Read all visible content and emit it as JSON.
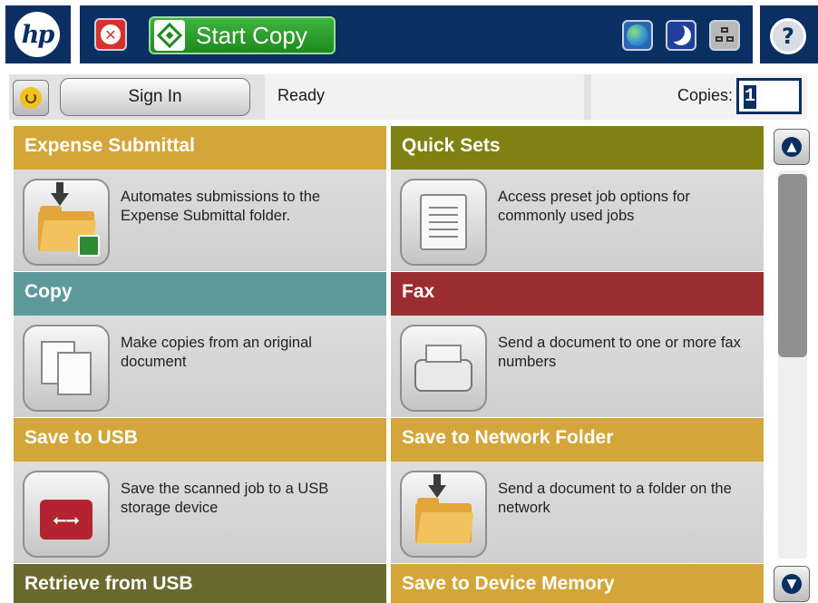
{
  "header": {
    "logo": "hp",
    "start_button_label": "Start Copy",
    "help_glyph": "?",
    "icons": [
      "hp-logo",
      "stop-icon",
      "start-icon",
      "language-globe-icon",
      "sleep-moon-icon",
      "network-icon",
      "help-icon"
    ]
  },
  "status": {
    "sign_in_label": "Sign In",
    "message": "Ready",
    "copies_label": "Copies:",
    "copies_value": "1"
  },
  "tiles": [
    {
      "title": "Expense Submittal",
      "description": "Automates submissions to the Expense Submittal folder.",
      "icon": "expense-submittal-folder-icon",
      "color": "#d4a63a"
    },
    {
      "title": "Quick Sets",
      "description": "Access preset job options for commonly used jobs",
      "icon": "quick-sets-document-icon",
      "color": "#7f8212"
    },
    {
      "title": "Copy",
      "description": "Make copies from an original document",
      "icon": "copy-documents-icon",
      "color": "#5e9a9b"
    },
    {
      "title": "Fax",
      "description": "Send a document to one or more fax numbers",
      "icon": "fax-machine-icon",
      "color": "#9b2d30"
    },
    {
      "title": "Save to USB",
      "description": "Save the scanned job to a USB storage device",
      "icon": "usb-drive-icon",
      "color": "#d4a63a"
    },
    {
      "title": "Save to Network Folder",
      "description": "Send a document to a folder on the network",
      "icon": "network-folder-icon",
      "color": "#d4a63a"
    },
    {
      "title": "Retrieve from USB",
      "description": "",
      "icon": "",
      "color": "#6a6a2f"
    },
    {
      "title": "Save to Device Memory",
      "description": "",
      "icon": "",
      "color": "#d4a63a"
    }
  ],
  "scroll": {
    "up_glyph": "⌃",
    "down_glyph": "⌄"
  }
}
